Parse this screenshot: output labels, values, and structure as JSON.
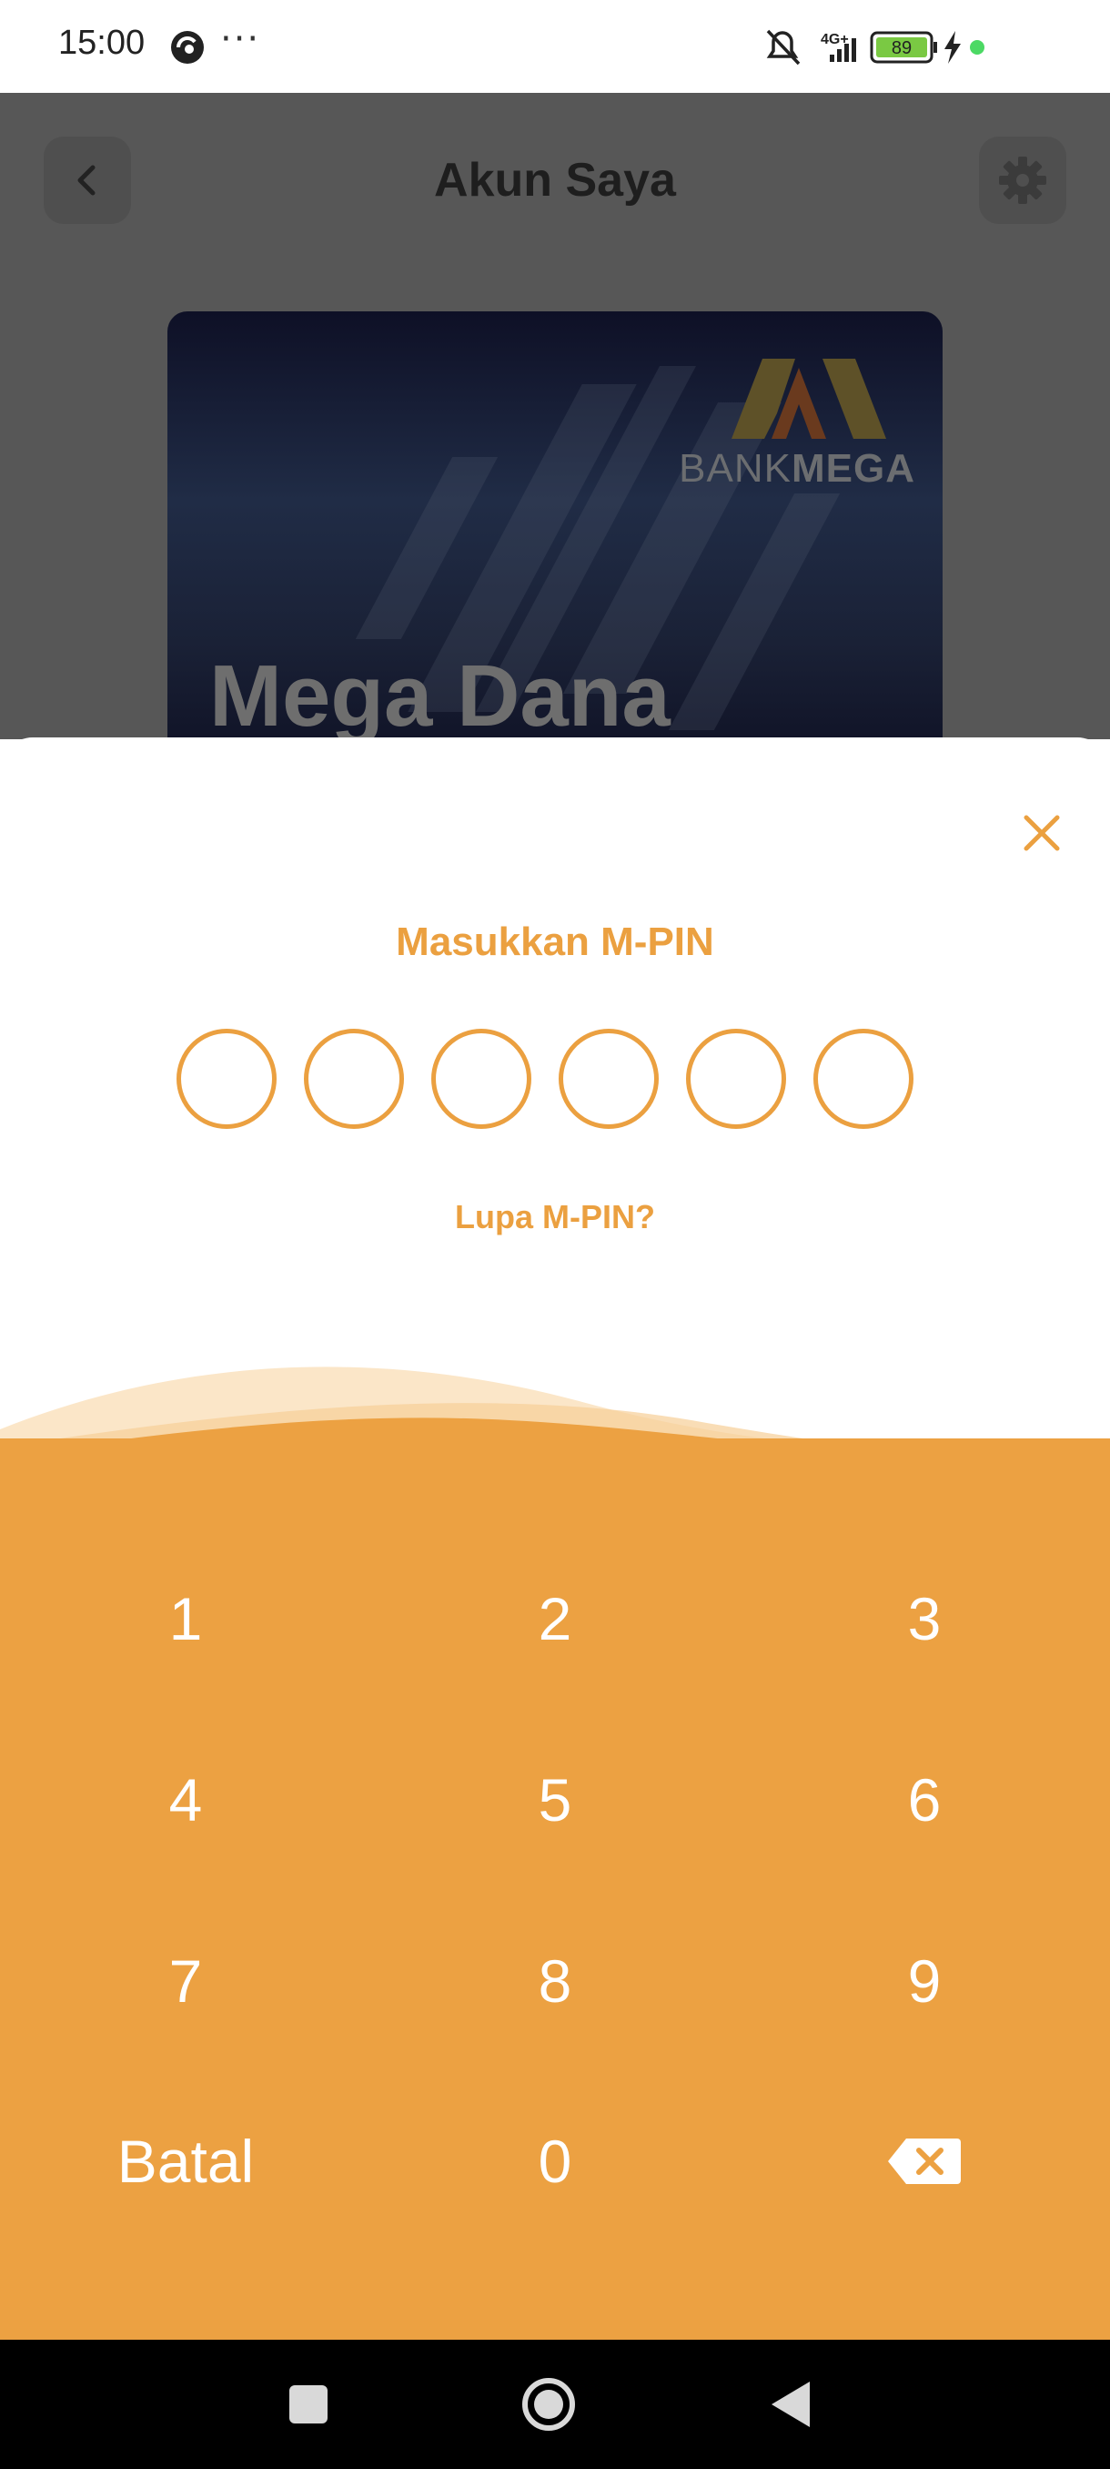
{
  "status_bar": {
    "time": "15:00",
    "network": "4G+",
    "battery": "89"
  },
  "background_screen": {
    "title": "Akun Saya",
    "card": {
      "bank_logo_light": "BANK",
      "bank_logo_bold": "MEGA",
      "product_name": "Mega Dana"
    }
  },
  "sheet": {
    "title": "Masukkan M-PIN",
    "pin_length": 6,
    "forgot_link": "Lupa M-PIN?"
  },
  "keypad": {
    "keys": [
      "1",
      "2",
      "3",
      "4",
      "5",
      "6",
      "7",
      "8",
      "9",
      "Batal",
      "0"
    ]
  },
  "colors": {
    "accent": "#eba040",
    "keypad": "#eca142",
    "scrim": "#575757"
  }
}
